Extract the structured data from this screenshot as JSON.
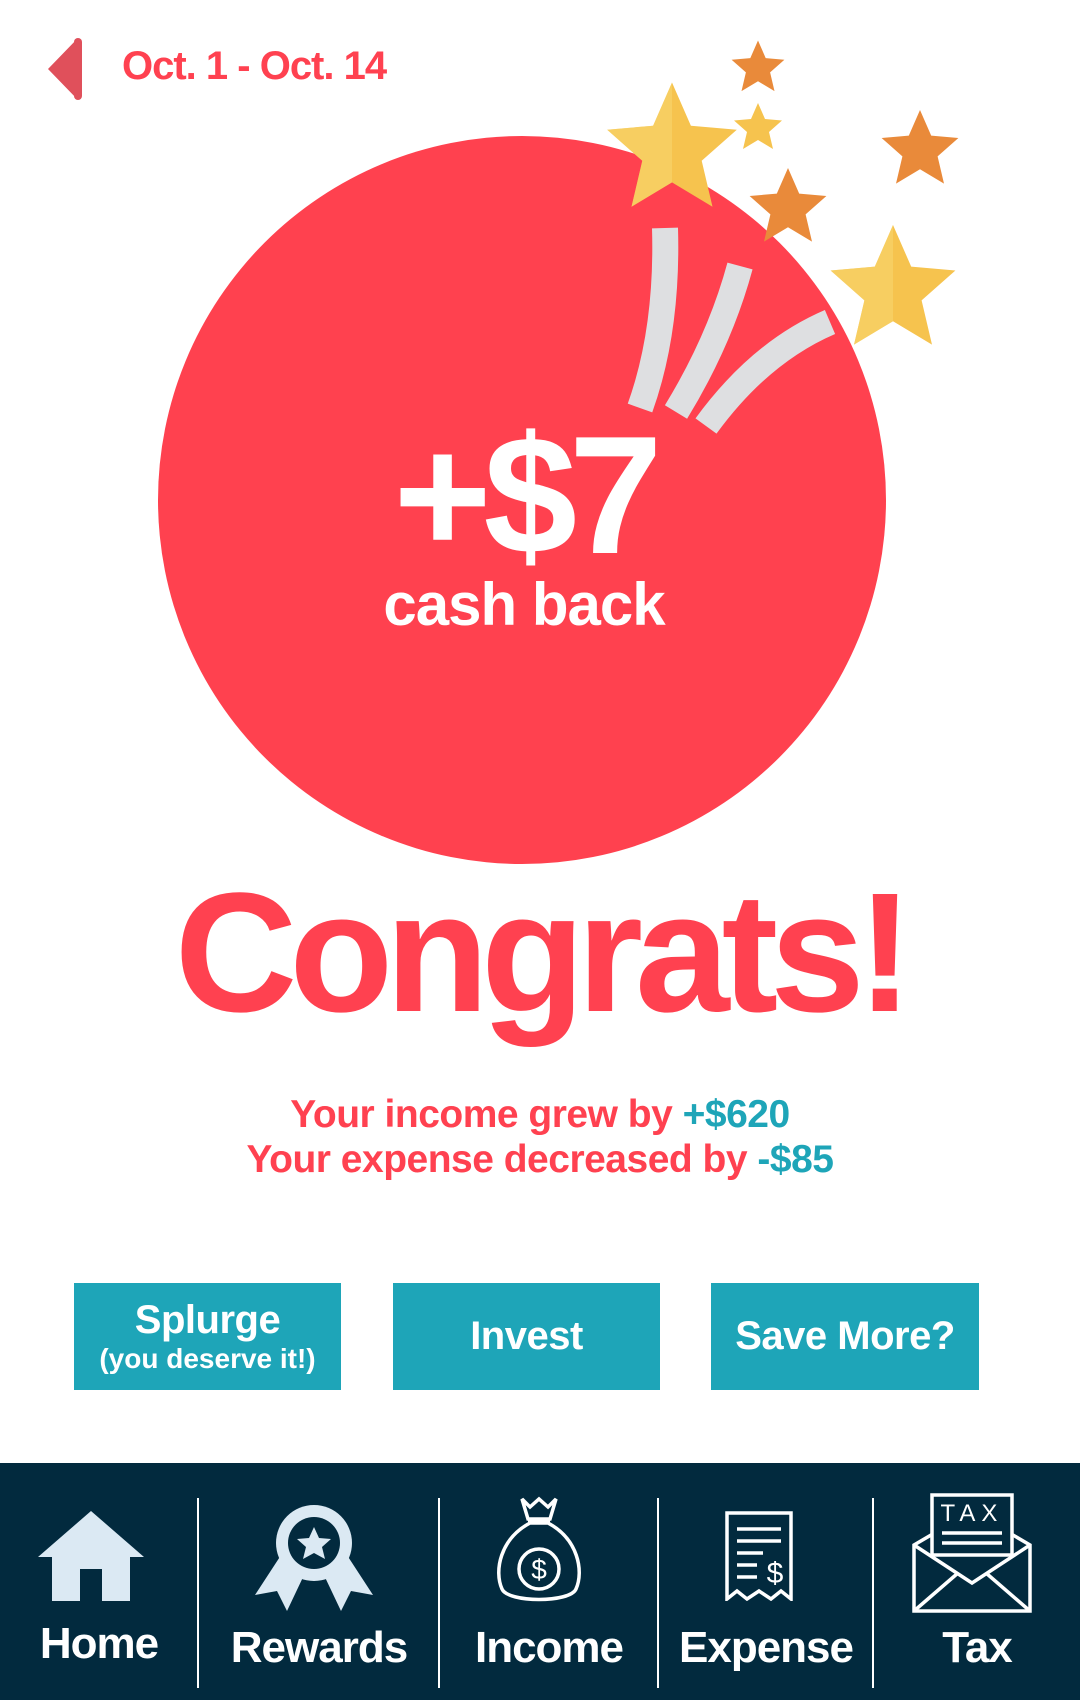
{
  "header": {
    "date_range": "Oct. 1 - Oct. 14"
  },
  "reward": {
    "amount": "+$7",
    "caption": "cash back"
  },
  "headline": "Congrats!",
  "stats": {
    "income_text": "Your income grew by",
    "income_value": "+$620",
    "expense_text": "Your expense decreased by",
    "expense_value": "-$85"
  },
  "actions": {
    "splurge_label": "Splurge",
    "splurge_sub": "(you deserve it!)",
    "invest_label": "Invest",
    "save_label": "Save More?"
  },
  "nav": {
    "items": [
      {
        "label": "Home",
        "icon": "home-icon"
      },
      {
        "label": "Rewards",
        "icon": "award-ribbon-icon"
      },
      {
        "label": "Income",
        "icon": "money-bag-icon"
      },
      {
        "label": "Expense",
        "icon": "receipt-icon"
      },
      {
        "label": "Tax",
        "icon": "tax-envelope-icon"
      }
    ]
  },
  "colors": {
    "accent_red": "#ff4150",
    "teal": "#1ea5b8",
    "nav_bg": "#022a3e",
    "star_yellow": "#f6c34e",
    "star_orange": "#e98a3a"
  }
}
